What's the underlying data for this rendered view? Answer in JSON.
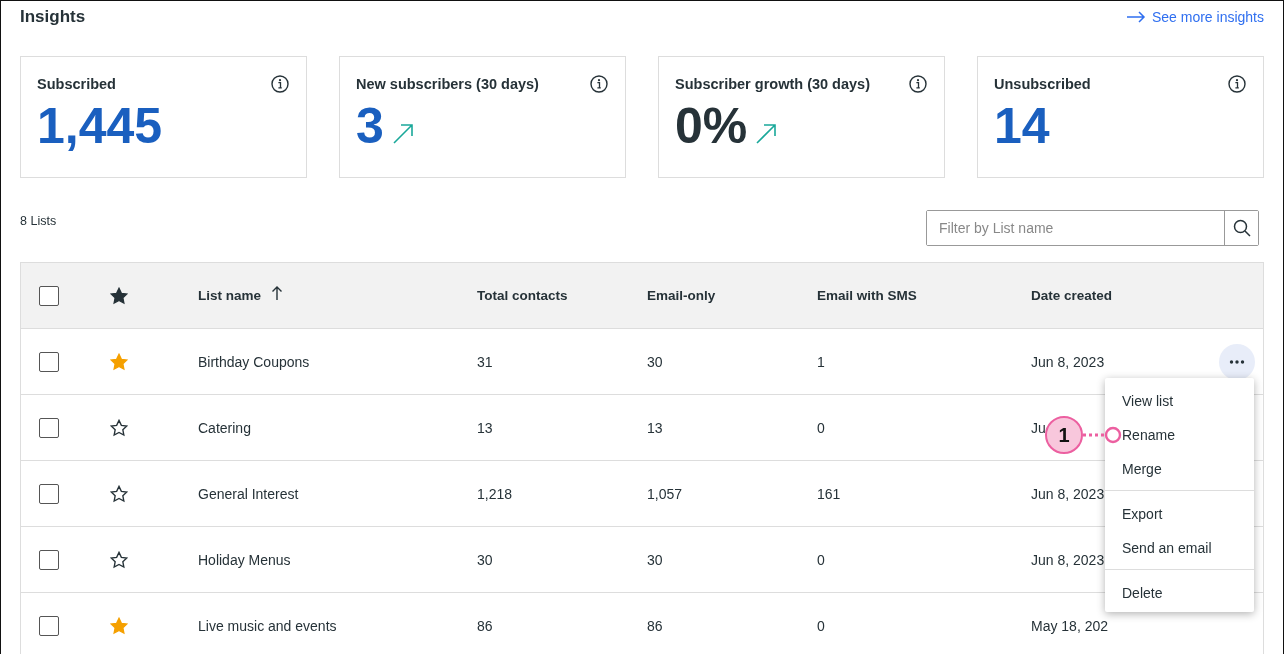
{
  "header": {
    "title": "Insights",
    "link": "See more insights"
  },
  "cards": [
    {
      "label": "Subscribed",
      "value": "1,445",
      "color": "#1a5fbf",
      "trend_up": false
    },
    {
      "label": "New subscribers (30 days)",
      "value": "3",
      "color": "#1a5fbf",
      "trend_up": true
    },
    {
      "label": "Subscriber growth (30 days)",
      "value": "0%",
      "color": "#263238",
      "trend_up": true
    },
    {
      "label": "Unsubscribed",
      "value": "14",
      "color": "#1a5fbf",
      "trend_up": false
    }
  ],
  "list_count": "8 Lists",
  "filter": {
    "placeholder": "Filter by List name"
  },
  "table": {
    "header_checked": false,
    "header_starred": true,
    "columns": [
      {
        "label": "List name",
        "sorted": true
      },
      {
        "label": "Total contacts",
        "sorted": false
      },
      {
        "label": "Email-only",
        "sorted": false
      },
      {
        "label": "Email with SMS",
        "sorted": false
      },
      {
        "label": "Date created",
        "sorted": false
      }
    ],
    "rows": [
      {
        "checked": false,
        "starred": true,
        "cells": [
          "Birthday Coupons",
          "31",
          "30",
          "1",
          "Jun 8, 2023"
        ],
        "menu_open": true
      },
      {
        "checked": false,
        "starred": false,
        "cells": [
          "Catering",
          "13",
          "13",
          "0",
          "Ju"
        ],
        "menu_open": false
      },
      {
        "checked": false,
        "starred": false,
        "cells": [
          "General Interest",
          "1,218",
          "1,057",
          "161",
          "Jun 8, 2023"
        ],
        "menu_open": false
      },
      {
        "checked": false,
        "starred": false,
        "cells": [
          "Holiday Menus",
          "30",
          "30",
          "0",
          "Jun 8, 2023"
        ],
        "menu_open": false
      },
      {
        "checked": false,
        "starred": true,
        "cells": [
          "Live music and events",
          "86",
          "86",
          "0",
          "May 18, 202"
        ],
        "menu_open": false
      }
    ]
  },
  "menu": {
    "groups": [
      [
        "View list",
        "Rename",
        "Merge"
      ],
      [
        "Export",
        "Send an email"
      ],
      [
        "Delete"
      ]
    ]
  },
  "callout": {
    "label": "1"
  }
}
